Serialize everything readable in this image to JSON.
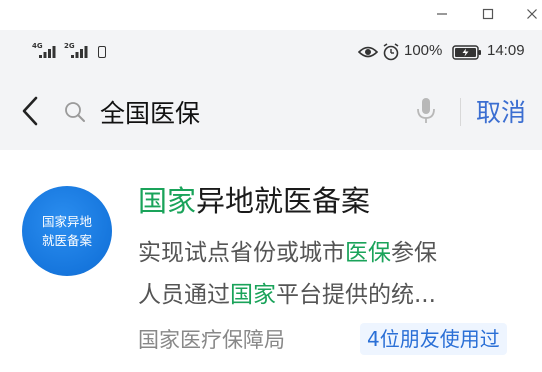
{
  "window": {
    "minimize_icon": "minimize-icon",
    "maximize_icon": "maximize-icon",
    "close_icon": "close-icon"
  },
  "status_bar": {
    "sim1_label": "4G",
    "sim2_label": "2G",
    "battery_percent": "100%",
    "time": "14:09"
  },
  "search": {
    "query": "全国医保",
    "cancel_label": "取消"
  },
  "result": {
    "logo_line1": "国家异地",
    "logo_line2": "就医备案",
    "title_highlight": "国家",
    "title_rest": "异地就医备案",
    "desc_line1_a": "实现试点省份或城市",
    "desc_line1_hl": "医保",
    "desc_line1_b": "参保",
    "desc_line2_a": "人员通过",
    "desc_line2_hl": "国家",
    "desc_line2_b": "平台提供的统...",
    "source": "国家医疗保障局",
    "friends_badge": "4位朋友使用过"
  },
  "colors": {
    "highlight": "#1aa35a",
    "accent_blue": "#3b6ed1",
    "logo_blue": "#1676dd",
    "header_bg": "#f3f4f6"
  }
}
